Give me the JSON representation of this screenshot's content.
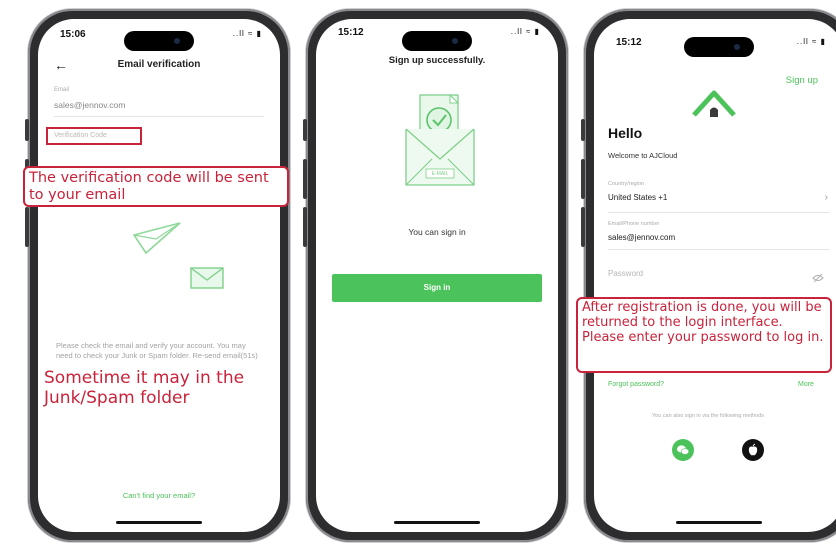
{
  "screens": {
    "verification": {
      "time": "15:06",
      "status_icons": "..ll ≈ ▮",
      "title": "Email verification",
      "email_label": "Email",
      "email_value": "sales@jennov.com",
      "code_placeholder": "Verification Code",
      "instructions": "Please check the email and verify your account. You may need to check your Junk or Spam folder. Re-send email(51s)",
      "cant_find_link": "Can't find your email?",
      "callout_top": "The verification code will be sent to your email",
      "callout_bottom": "Sometime it may in the Junk/Spam folder"
    },
    "success": {
      "time": "15:12",
      "status_icons": "..ll ≈ ▮",
      "title": "Sign up successfully.",
      "envelope_label": "E-MAIL",
      "message": "You can sign in",
      "sign_in_button": "Sign in"
    },
    "login": {
      "time": "15:12",
      "status_icons": "..ll ≈ ▮",
      "sign_up_link": "Sign up",
      "greeting": "Hello",
      "welcome": "Welcome to AJCloud",
      "country_label": "Country/region",
      "country_value": "United States +1",
      "email_label": "Email/Phone number",
      "email_value": "sales@jennov.com",
      "password_placeholder": "Password",
      "forgot_password": "Forgot password?",
      "more": "More",
      "alt_signin": "You can also sign in via the following methods",
      "callout": "After registration is done, you will be returned to the login interface. Please enter your password to log in."
    }
  },
  "colors": {
    "accent": "#4cc35a",
    "callout": "#c8233a"
  }
}
